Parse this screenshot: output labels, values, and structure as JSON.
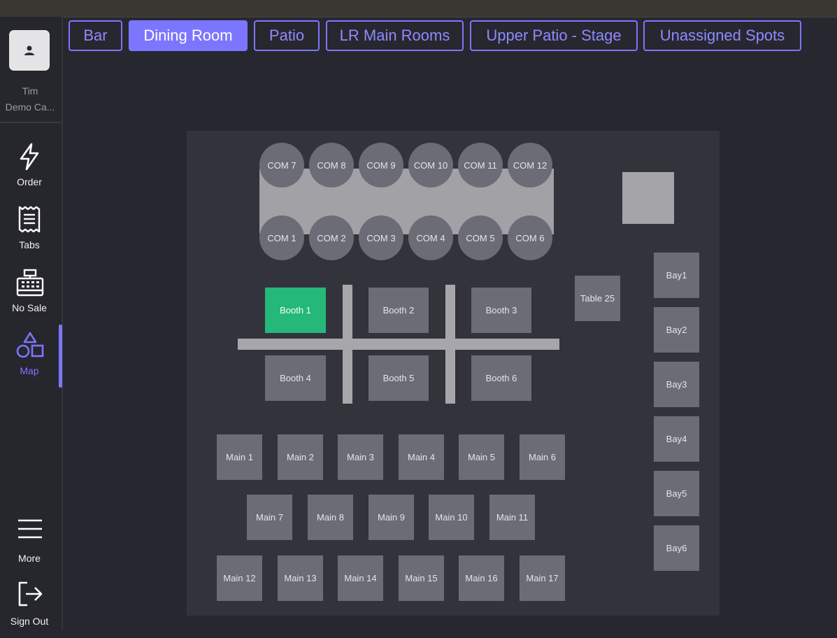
{
  "user": {
    "name": "Tim",
    "company": "Demo Ca..."
  },
  "nav": [
    {
      "id": "order",
      "label": "Order",
      "icon": "lightning-icon"
    },
    {
      "id": "tabs",
      "label": "Tabs",
      "icon": "receipt-icon"
    },
    {
      "id": "no-sale",
      "label": "No Sale",
      "icon": "cash-register-icon"
    },
    {
      "id": "map",
      "label": "Map",
      "icon": "shapes-icon",
      "active": true
    },
    {
      "id": "more",
      "label": "More",
      "icon": "menu-icon"
    },
    {
      "id": "sign-out",
      "label": "Sign Out",
      "icon": "sign-out-icon"
    }
  ],
  "tabs": [
    {
      "label": "Bar"
    },
    {
      "label": "Dining Room",
      "active": true
    },
    {
      "label": "Patio"
    },
    {
      "label": "LR Main Rooms"
    },
    {
      "label": "Upper Patio - Stage"
    },
    {
      "label": "Unassigned Spots"
    }
  ],
  "tables": {
    "com_top": [
      "COM 7",
      "COM 8",
      "COM 9",
      "COM 10",
      "COM 11",
      "COM 12"
    ],
    "com_bottom": [
      "COM 1",
      "COM 2",
      "COM 3",
      "COM 4",
      "COM 5",
      "COM 6"
    ],
    "booths_top": [
      "Booth 1",
      "Booth 2",
      "Booth 3"
    ],
    "booths_bottom": [
      "Booth 4",
      "Booth 5",
      "Booth 6"
    ],
    "occupied": [
      "Booth 1"
    ],
    "table_25": "Table 25",
    "bays": [
      "Bay1",
      "Bay2",
      "Bay3",
      "Bay4",
      "Bay5",
      "Bay6"
    ],
    "main_row1": [
      "Main 1",
      "Main 2",
      "Main 3",
      "Main 4",
      "Main 5",
      "Main 6"
    ],
    "main_row2": [
      "Main 7",
      "Main 8",
      "Main 9",
      "Main 10",
      "Main 11"
    ],
    "main_row3": [
      "Main 12",
      "Main 13",
      "Main 14",
      "Main 15",
      "Main 16",
      "Main 17"
    ]
  },
  "colors": {
    "accent": "#7c76ff",
    "occupied": "#24b87a",
    "table": "#6c6c76",
    "floor": "#33333b",
    "background": "#272730"
  }
}
